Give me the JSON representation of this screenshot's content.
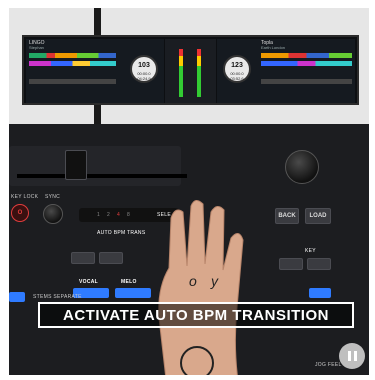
{
  "screen": {
    "deck_a": {
      "title": "LINGO",
      "artist": "Stephan",
      "bpm": "103",
      "time1": "00:00.0",
      "time2": "04:24.9"
    },
    "deck_b": {
      "title": "Topla",
      "artist": "Earth London",
      "bpm": "123",
      "time1": "00:00.0",
      "time2": "03:52.6"
    }
  },
  "controller": {
    "key_lock": "KEY LOCK",
    "sync": "SYNC",
    "auto_bpm": "AUTO BPM TRANS",
    "select": "SELE",
    "back": "BACK",
    "load": "LOAD",
    "key": "KEY",
    "vocal": "VOCAL",
    "melody": "MELO",
    "stems_separate": "STEMS SEPARATE",
    "jog_feel": "JOG FEEL",
    "fx_indicators": [
      "1",
      "2",
      "4",
      "8"
    ]
  },
  "banner": {
    "text": "ACTIVATE AUTO BPM TRANSITION"
  },
  "colors": {
    "accent_red": "#e03c3c",
    "accent_blue": "#2f7bff",
    "banner_border": "#ffffff"
  }
}
